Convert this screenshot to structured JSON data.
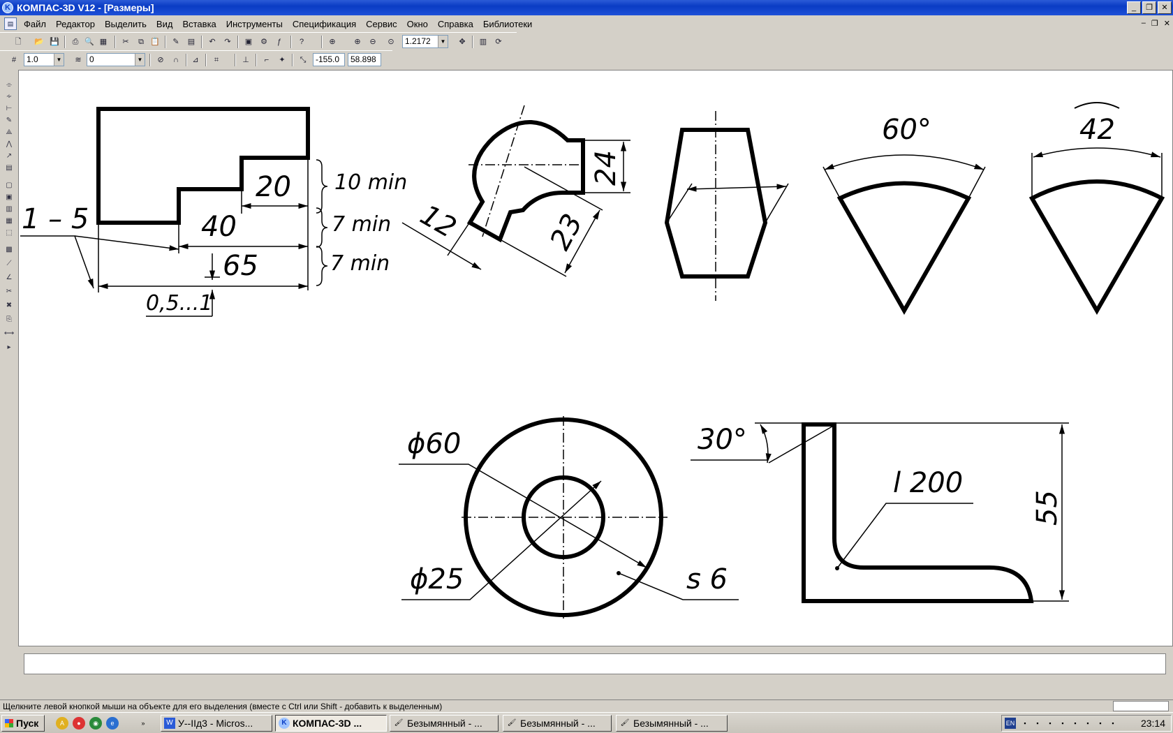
{
  "window": {
    "app_icon": "kompas-logo-icon",
    "title": "КОМПАС-3D V12 - [Размеры]",
    "controls": [
      "_",
      "❐",
      "✕"
    ]
  },
  "menu": {
    "doc_icon": "document-icon",
    "items": [
      "Файл",
      "Редактор",
      "Выделить",
      "Вид",
      "Вставка",
      "Инструменты",
      "Спецификация",
      "Сервис",
      "Окно",
      "Справка",
      "Библиотеки"
    ],
    "mdi_controls": [
      "–",
      "❐",
      "✕"
    ]
  },
  "toolbar": {
    "zoom_value": "1.2172",
    "icons": [
      "new-icon",
      "open-icon",
      "save-icon",
      "print-icon",
      "preview-icon",
      "print-setup-icon",
      "cut-icon",
      "copy-icon",
      "paste-icon",
      "properties-icon",
      "library-icon",
      "undo-icon",
      "redo-icon",
      "manager-icon",
      "variables-icon",
      "fx-icon",
      "help-icon",
      "zoom-window-icon",
      "zoom-in-icon",
      "zoom-out-icon",
      "zoom-scale-icon",
      "pan-icon",
      "layers-icon",
      "refresh-icon"
    ]
  },
  "toolbar2": {
    "step_value": "1.0",
    "layer_value": "0",
    "x_coord": "-155.0",
    "y_coord": "58.898",
    "icons": [
      "grid-step-icon",
      "layer-icon",
      "snap-icon",
      "magnet-icon",
      "ortho-icon",
      "grid-icon",
      "local-cs-icon",
      "round-icon",
      "snap-mode-icon",
      "coord-icon"
    ]
  },
  "drawing": {
    "texts": {
      "t_1_5": "1 – 5",
      "t_20": "20",
      "t_40": "40",
      "t_65": "65",
      "t_10min": "10 min",
      "t_7min_a": "7 min",
      "t_7min_b": "7 min",
      "t_05_1": "0,5...1",
      "t_12": "12",
      "t_23": "23",
      "t_24": "24",
      "t_60deg": "60°",
      "t_42": "42",
      "t_phi60": "ϕ60",
      "t_phi25": "ϕ25",
      "t_s6": "s 6",
      "t_30deg": "30°",
      "t_l200": "l 200",
      "t_55": "55"
    }
  },
  "statusbar": {
    "message": "Щелкните левой кнопкой мыши на объекте для его выделения (вместе с Ctrl или Shift - добавить к выделенным)"
  },
  "taskbar": {
    "start_label": "Пуск",
    "tasks": [
      {
        "label": "У--IIд3 - Micros...",
        "icon": "word-icon"
      },
      {
        "label": "КОМПАС-3D ...",
        "icon": "kompas-icon",
        "active": true
      },
      {
        "label": "Безымянный - ...",
        "icon": "paint-icon"
      },
      {
        "label": "Безымянный - ...",
        "icon": "paint-icon"
      },
      {
        "label": "Безымянный - ...",
        "icon": "paint-icon"
      }
    ],
    "lang": "EN",
    "clock": "23:14"
  }
}
